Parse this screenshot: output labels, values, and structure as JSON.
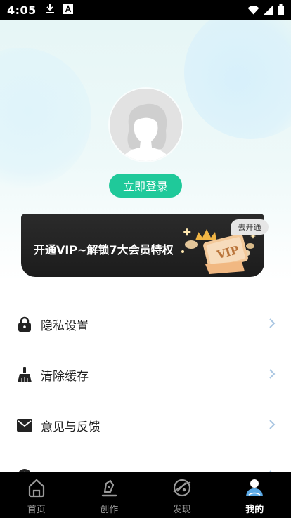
{
  "status_bar": {
    "time": "4:05",
    "icons": [
      "download-icon",
      "keyboard-a-icon",
      "wifi-icon",
      "signal-icon",
      "battery-icon"
    ]
  },
  "profile": {
    "avatar": "default-avatar-icon",
    "login_label": "立即登录"
  },
  "vip_banner": {
    "text": "开通VIP~解锁7大会员特权",
    "go_label": "去开通",
    "badge_text": "VIP"
  },
  "menu": {
    "items": [
      {
        "label": "隐私设置",
        "icon": "lock-icon"
      },
      {
        "label": "清除缓存",
        "icon": "broom-icon"
      },
      {
        "label": "意见与反馈",
        "icon": "mail-icon"
      },
      {
        "label": "",
        "icon": "info-icon"
      }
    ]
  },
  "bottom_nav": {
    "items": [
      {
        "label": "首页",
        "icon": "home-icon"
      },
      {
        "label": "创作",
        "icon": "pen-icon"
      },
      {
        "label": "发现",
        "icon": "discover-icon"
      },
      {
        "label": "我的",
        "icon": "profile-icon"
      }
    ],
    "active_index": 3
  },
  "colors": {
    "accent": "#1fc99a",
    "banner_bg": "#1c1c1c",
    "chevron": "#a9c6e2",
    "nav_bg": "#000000"
  }
}
